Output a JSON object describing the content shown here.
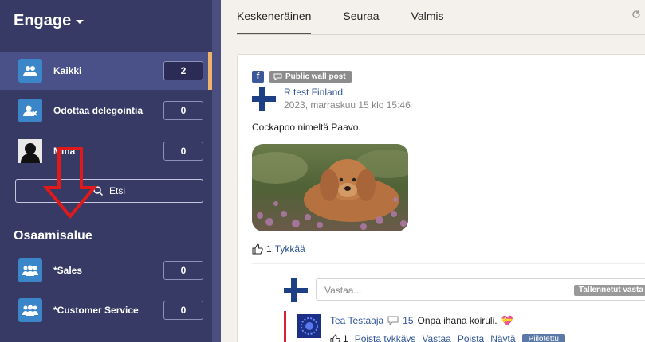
{
  "sidebar": {
    "brand": "Engage",
    "items": [
      {
        "label": "Kaikki",
        "count": "2"
      },
      {
        "label": "Odottaa delegointia",
        "count": "0"
      },
      {
        "label": "Minä",
        "count": "0"
      }
    ],
    "search_label": "Etsi",
    "section_title": "Osaamisalue",
    "section_items": [
      {
        "label": "*Sales",
        "count": "0"
      },
      {
        "label": "*Customer Service",
        "count": "0"
      }
    ]
  },
  "tabs": [
    "Keskeneräinen",
    "Seuraa",
    "Valmis"
  ],
  "post": {
    "source_badge": "Public wall post",
    "author": "R test Finland",
    "timestamp": "2023, marraskuu 15 klo 15:46",
    "text": "Cockapoo nimeltä Paavo.",
    "like_count": "1",
    "like_label": "Tykkää",
    "reply_placeholder": "Vastaa...",
    "saved_replies_label": "Tallennetut vasta"
  },
  "comment": {
    "author": "Tea Testaaja",
    "reply_count": "15",
    "text": "Onpa ihana koiruli.",
    "emoji": "💝",
    "like_count": "1",
    "actions": [
      "Poista tykkäys",
      "Vastaa",
      "Poista",
      "Näytä"
    ],
    "hidden_badge": "Piilotettu"
  },
  "colors": {
    "sidebar_bg": "#363a65",
    "accent": "#f0b36a",
    "link": "#2f5597",
    "alert": "#d6213a"
  }
}
